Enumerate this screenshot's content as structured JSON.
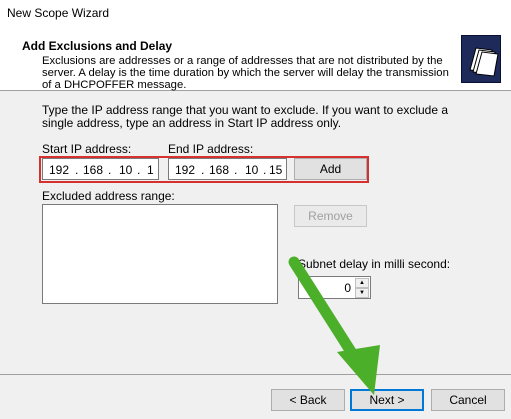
{
  "window": {
    "title": "New Scope Wizard"
  },
  "header": {
    "title": "Add Exclusions and Delay",
    "description": "Exclusions are addresses or a range of addresses that are not distributed by the server. A delay is the time duration by which the server will delay the transmission of a DHCPOFFER message."
  },
  "body": {
    "instructions": "Type the IP address range that you want to exclude. If you want to exclude a single address, type an address in Start IP address only.",
    "start_ip": {
      "label": "Start IP address:",
      "octets": [
        "192",
        "168",
        "10",
        "1"
      ]
    },
    "end_ip": {
      "label": "End IP address:",
      "octets": [
        "192",
        "168",
        "10",
        "15"
      ]
    },
    "add_label": "Add",
    "excluded_label": "Excluded address range:",
    "remove_label": "Remove",
    "delay_label": "Subnet delay in milli second:",
    "delay_value": "0"
  },
  "footer": {
    "back_label": "< Back",
    "next_label": "Next >",
    "cancel_label": "Cancel"
  },
  "colors": {
    "highlight_box": "#d5322f",
    "arrow": "#4caf2a"
  },
  "icons": [
    "folders-icon",
    "spin-up-icon",
    "spin-down-icon",
    "pointer-arrow-icon"
  ]
}
